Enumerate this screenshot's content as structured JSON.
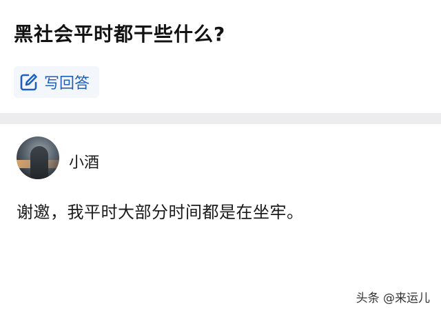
{
  "question": {
    "title": "黑社会平时都干些什么?"
  },
  "actions": {
    "write_answer_label": "写回答",
    "write_answer_icon": "edit-icon",
    "accent_color": "#1e5fbd"
  },
  "answer": {
    "author_name": "小酒",
    "content": "谢邀，我平时大部分时间都是在坐牢。"
  },
  "watermark": {
    "source": "头条 @来运儿"
  }
}
